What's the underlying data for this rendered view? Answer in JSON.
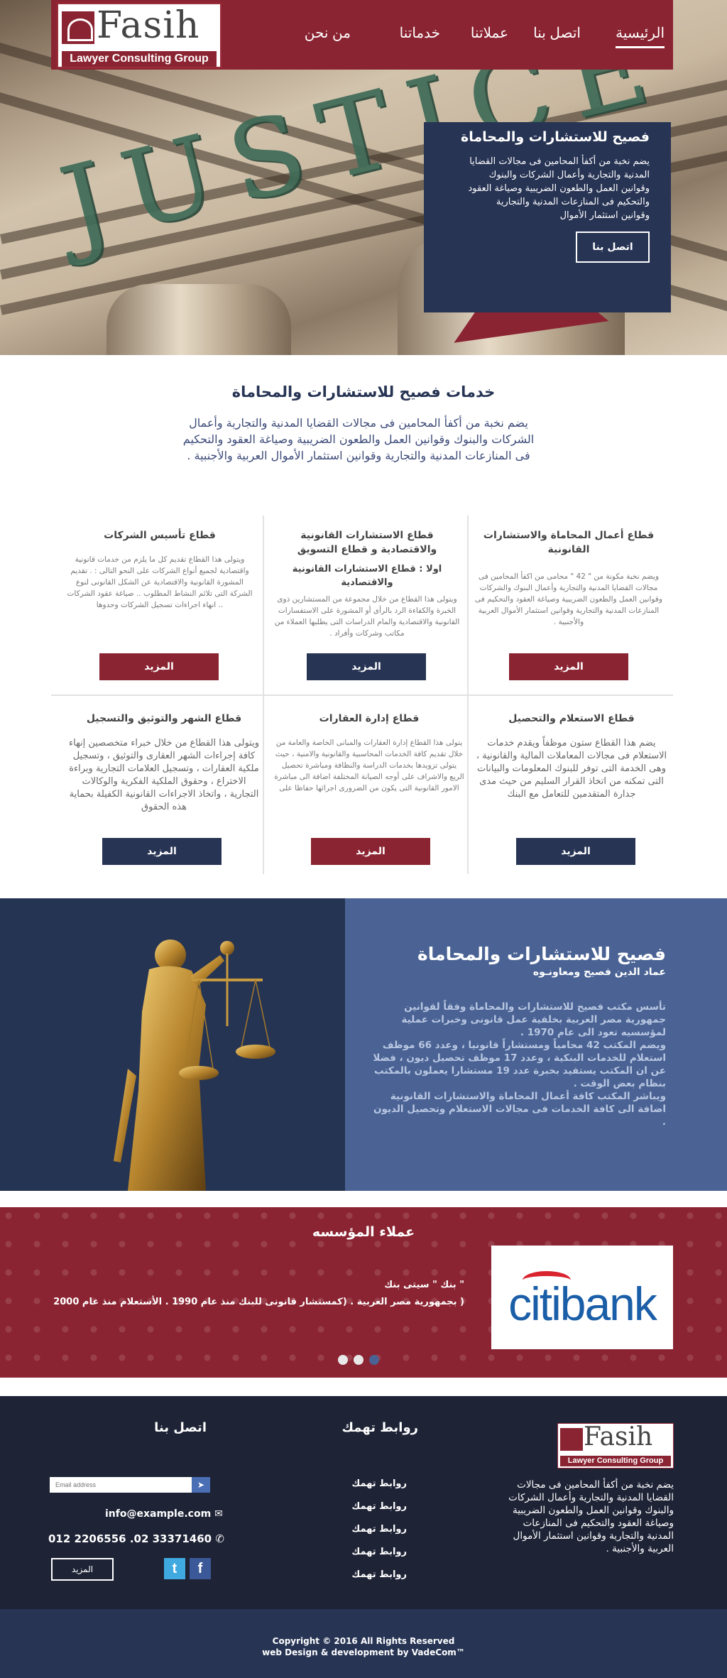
{
  "nav": {
    "logo": {
      "name": "Fasih",
      "tagline": "Lawyer Consulting Group"
    },
    "items": [
      "الرئيسية",
      "اتصل بنا",
      "عملاتنا",
      "خدماتنا",
      "من نحن"
    ]
  },
  "hero": {
    "engraving": "JUSTICE",
    "title": "فصيح للاستشارات والمحاماة",
    "description": "يضم نخبة من أكفأ المحامين فى مجالات القضايا المدنية والتجارية وأعمال الشركات والبنوك وقوانين العمل والطعون الضريبية وصياغة العقود والتحكيم فى المنازعات المدنية والتجارية وقوانين استثمار الأموال",
    "button": "اتصل بنا"
  },
  "services": {
    "title": "خدمات فصيح للاستشارات والمحاماة",
    "description": "يضم نخبة من أكفأ المحامين فى مجالات القضايا المدنية والتجارية وأعمال الشركات والبنوك وقوانين العمل والطعون الضريبية وصياغة العقود والتحكيم فى المنازعات المدنية والتجارية وقوانين استثمار الأموال العربية والأجنبية .",
    "cards": [
      {
        "title": "قطاع أعمال المحاماة والاستشارات القانونية",
        "subtitle": "",
        "text": "ويضم نخبة مكونة من \" 42 \" محامى من اكفأ المحامين فى مجالات القضايا المدنية والتجارية وأعمال البنوك والشركات وقوانين العمل والطعون الضريبية وصياغة العقود والتحكيم فى المنازعات المدنية والتجارية وقوانين استثمار الأموال العربية والأجنبية .",
        "button": "المزيد"
      },
      {
        "title": "قطاع الاستشارات القانونية والاقتصادية و قطاع التسويق",
        "subtitle": "اولا : قطاع الاستشارات القانونية والاقتصادية",
        "text": "ويتولى هذا القطاع من خلال مجموعة من المستشارين ذوى الخبرة والكفاءة الرد بالرأى أو المشورة على الاستفسارات القانونية والاقتصادية والمام الدراسات التى يطلبها العملاء من مكاتب وشركات وأفراد .",
        "button": "المزيد"
      },
      {
        "title": "قطاع تأسيس الشركات",
        "subtitle": "",
        "text": "ويتولى هذا القطاع تقديم كل ما يلزم من خدمات قانونية واقتصادية لجميع أنواع الشركات على النحو التالى : . تقديم المشورة القانونية والاقتصادية عن الشكل القانونى لنوع الشركة التى تلائم النشاط المطلوب .. صياغة عقود الشركات .. انهاء اجراءات تسجيل الشركات وحدوها",
        "button": "المزيد"
      },
      {
        "title": "قطاع الاستعلام والتحصيل",
        "subtitle": "",
        "text": "يضم هذا القطاع ستون موظفاً ويقدم خدمات الاستعلام فى مجالات المعاملات المالية والقانونية ، وهى الخدمة التى توفر للبنوك المعلومات والبيانات التى تمكنه من اتخاذ القرار السليم من حيث مدى جدارة المتقدمين للتعامل مع البنك",
        "button": "المزيد"
      },
      {
        "title": "قطاع إدارة العقارات",
        "subtitle": "",
        "text": "يتولى هذا القطاع إدارة العقارات والمبانى الخاصة والعامة من خلال تقديم كافة الخدمات المحاسبية والقانونية والامنية ، حيث يتولى تزويدها بخدمات الدراسة والنظافة ومباشرة تحصيل الريع والاشراف على أوجه الصيانة المختلفة اضافة الى مباشرة الامور القانونية التى يكون من الضرورى اجرائها حفاظا على",
        "button": "المزيد"
      },
      {
        "title": "قطاع الشهر والتوثيق والتسجيل",
        "subtitle": "",
        "text": "ويتولى هذا القطاع من خلال خبراء متخصصين إنهاء كافة إجراءات الشهر العقارى والتوثيق ، وتسجيل ملكية العقارات ، وتسجيل العلامات التجارية وبراءة الاختراع ، وحقوق الملكية الفكرية والوكالات التجارية ، واتخاذ الاجراءات القانونية الكفيلة بحماية هذه الحقوق",
        "button": "المزيد"
      }
    ]
  },
  "about": {
    "title": "فصيح للاستشارات والمحاماة",
    "subtitle": "عماد الدين فصيح ومعاونـوه",
    "paragraphs": [
      "تأسس مكتب فصيح للاستشارات والمحاماة وفقاً لقوانين جمهورية مصر العربية بخلفية عمل قانونى وخبرات عملية لمؤسسيه تعود الى عام 1970 .",
      "ويضم المكتب 42 محامياً ومستشاراً قانونيا ، وعدد 66 موظف استعلام للخدمات البنكية ، وعدد 17 موظف تحصيل ديون ، فضلا عن ان المكتب يستفيد بخبرة عدد 19 مستشارا يعملون بالمكتب بنظام بعض الوقت .",
      "ويباشر المكتب كافة أعمال المحاماة والاستشارات القانونية اضافة الى كافة الخدمات فى مجالات الاستعلام وتحصيل الديون ."
    ]
  },
  "clients": {
    "title": "عملاء المؤسسه",
    "logo_text": {
      "part1": "citi",
      "part2": "bank"
    },
    "client_name": "\" بنك \" سيتى بنك",
    "client_desc": "( بجمهورية مصر العربية . (كمستشار قانونى للبنك منذ عام 1990 . الأستعلام منذ عام 2000"
  },
  "footer": {
    "logo": {
      "name": "Fasih",
      "tagline": "Lawyer Consulting Group"
    },
    "description": "يضم نخبة من أكفأ المحامين فى مجالات القضايا المدنية والتجارية وأعمال الشركات والبنوك وقوانين العمل والطعون الضريبية وصياغة العقود والتحكيم فى المنازعات المدنية والتجارية وقوانين استثمار الأموال العربية والأجنبية .",
    "links_title": "روابط تهمك",
    "links": [
      "روابط تهمك",
      "روابط تهمك",
      "روابط تهمك",
      "روابط تهمك",
      "روابط تهمك"
    ],
    "contact_title": "اتصل بنا",
    "email_placeholder": "Email address",
    "email": "info@example.com",
    "phone": "012 2206556 .02 33371460",
    "more_button": "المزيد",
    "social": [
      "twitter-icon",
      "facebook-icon"
    ]
  },
  "copyright": {
    "line1": "Copyright © 2016 All Rights Reserved",
    "line2": "web Design & development by VadeCom™"
  },
  "colors": {
    "brand_red": "#8b2432",
    "navy": "#273454",
    "blue": "#4a6394"
  }
}
